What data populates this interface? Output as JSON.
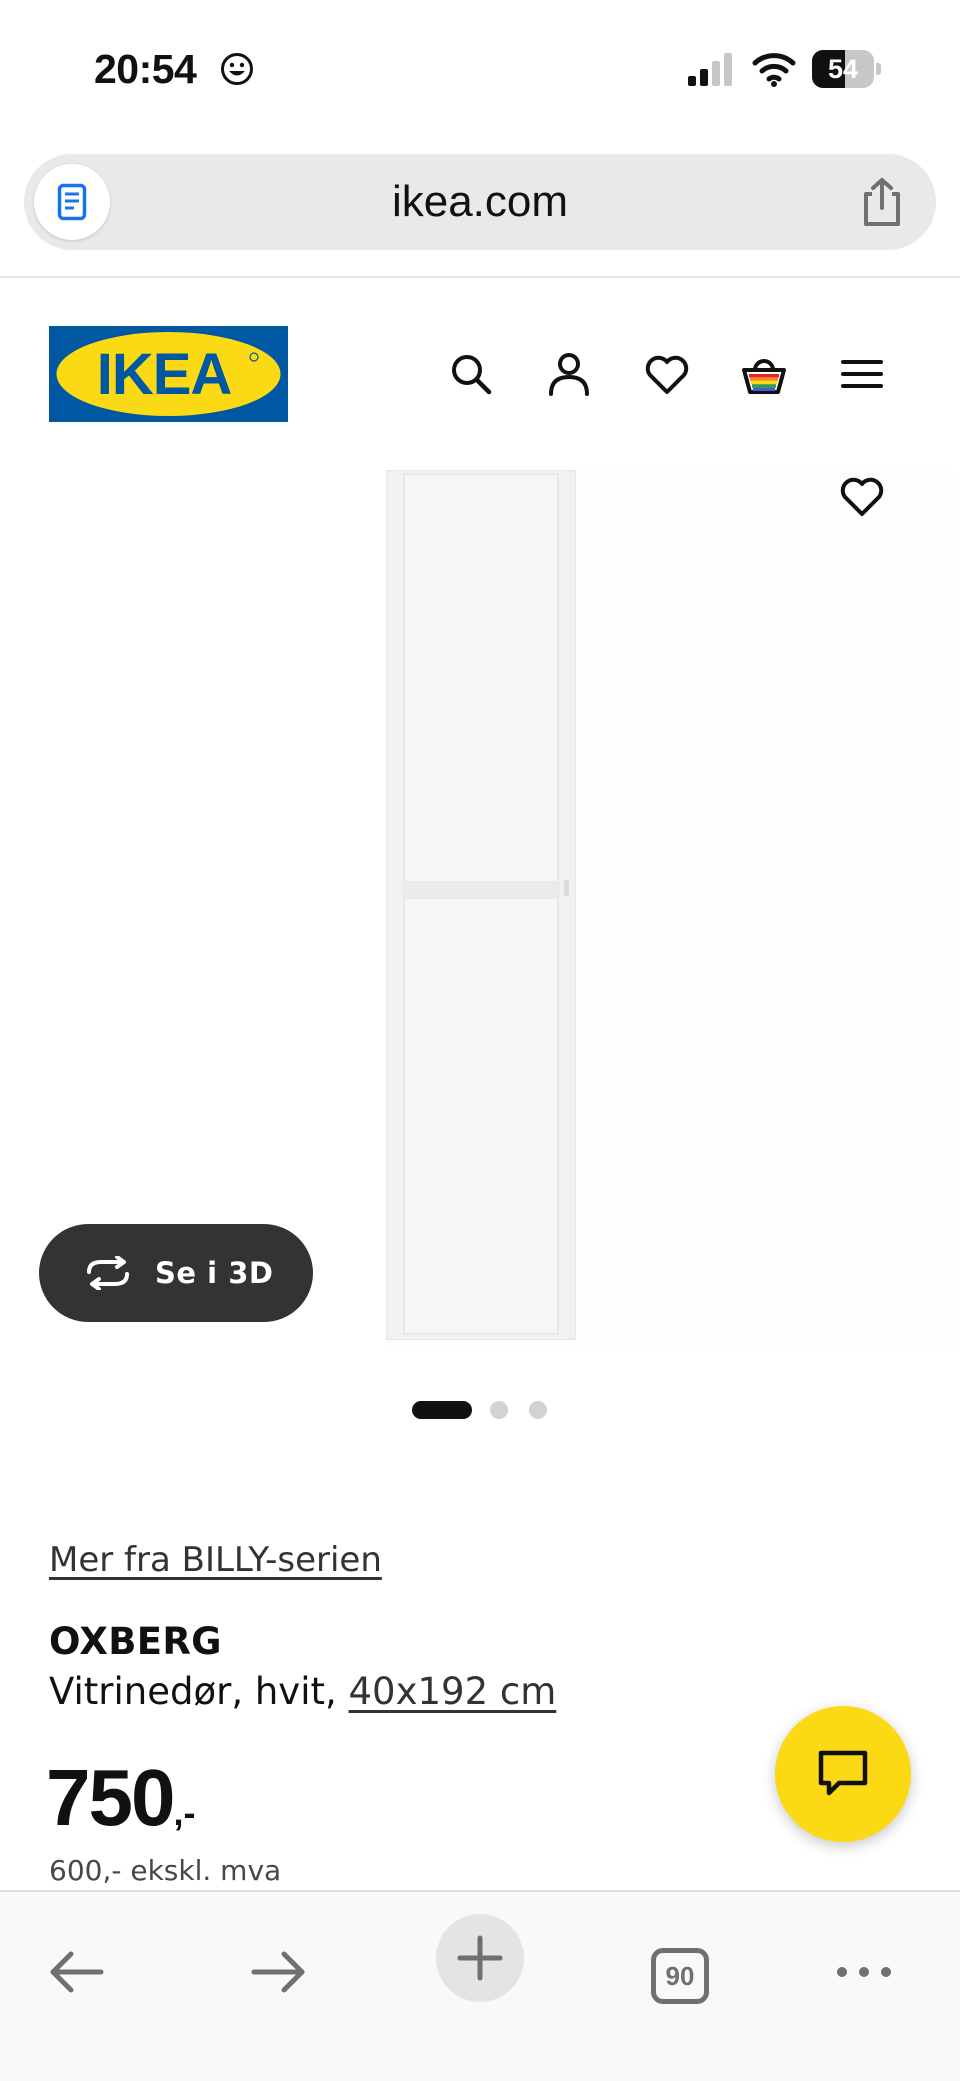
{
  "status_bar": {
    "time": "20:54",
    "battery_level": "54",
    "battery_fraction": 0.54
  },
  "browser": {
    "url": "ikea.com",
    "open_tabs": "90"
  },
  "header": {
    "logo_text": "IKEA",
    "brand_blue": "#0058a3",
    "brand_yellow": "#fbd914",
    "icons": [
      "search-icon",
      "account-icon",
      "favorites-icon",
      "basket-icon",
      "menu-icon"
    ]
  },
  "gallery": {
    "view_3d_label": "Se i 3D",
    "slide_count": 3,
    "active_slide": 1
  },
  "product": {
    "series_link": "Mer fra BILLY-serien",
    "name": "OXBERG",
    "description_prefix": "Vitrinedør, hvit, ",
    "size_link": "40x192 cm",
    "price_main": "750",
    "price_suffix": ",-",
    "price_ex_vat": "600,- ekskl. mva"
  }
}
